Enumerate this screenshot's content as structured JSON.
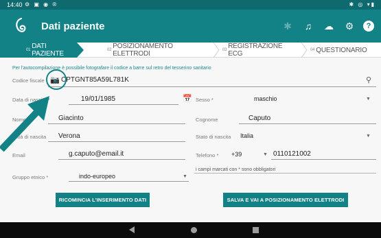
{
  "status_bar": {
    "time": "14:40",
    "left_icons": "⚙ ▣ ◉ ®",
    "right_icons": "✱ ◎ ▾▮"
  },
  "app_bar": {
    "title": "Dati paziente",
    "actions": [
      {
        "icon": "bluetooth-icon",
        "glyph": "✱",
        "enabled": false
      },
      {
        "icon": "headphones-icon",
        "glyph": "♫",
        "enabled": true
      },
      {
        "icon": "cloud-sync-icon",
        "glyph": "☁",
        "enabled": true
      },
      {
        "icon": "gear-icon",
        "glyph": "⚙",
        "enabled": true
      },
      {
        "icon": "help-icon",
        "glyph": "?",
        "enabled": true
      }
    ]
  },
  "tabs": [
    {
      "num": "01",
      "label": "DATI PAZIENTE",
      "active": true
    },
    {
      "num": "02",
      "label": "POSIZIONAMENTO ELETTRODI",
      "active": false
    },
    {
      "num": "03",
      "label": "REGISTRAZIONE ECG",
      "active": false
    },
    {
      "num": "04",
      "label": "QUESTIONARIO",
      "active": false
    }
  ],
  "form": {
    "hint": "Per l'autocompilazione è possibile fotografare il codice a barre sul retro del tesserino sanitario",
    "codice_fiscale": {
      "label": "Codice fiscale",
      "value": "CPTGNT85A59L781K"
    },
    "data_nascita": {
      "label": "Data di nascita *",
      "value": "19/01/1985"
    },
    "sesso": {
      "label": "Sesso *",
      "value": "maschio"
    },
    "nome": {
      "label": "Nome *",
      "value": "Giacinto"
    },
    "cognome": {
      "label": "Cognome",
      "value": "Caputo"
    },
    "citta_nascita": {
      "label": "Città di nascita",
      "value": "Verona"
    },
    "stato_nascita": {
      "label": "Stato di nascita",
      "value": "Italia"
    },
    "email": {
      "label": "Email",
      "value": "g.caputo@email.it"
    },
    "telefono": {
      "label": "Telefono *",
      "prefix": "+39",
      "value": "0110121002"
    },
    "gruppo_etnico": {
      "label": "Gruppo etnico *",
      "value": "indo-europeo"
    },
    "required_note": "i campi marcati con * sono obbligatori"
  },
  "buttons": {
    "restart": "RICOMINCIA L'INSERIMENTO DATI",
    "save_next": "SALVA E VAI A POSIZIONAMENTO ELETTRODI"
  },
  "colors": {
    "primary": "#128287",
    "status_bar": "#0e6a6e",
    "annotation": "#128287"
  }
}
